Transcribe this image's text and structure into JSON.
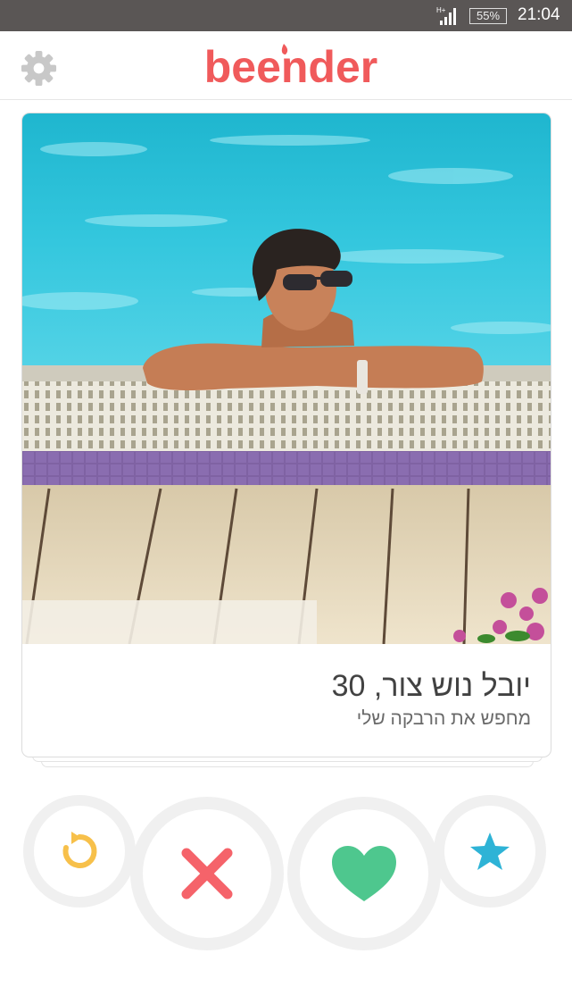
{
  "status_bar": {
    "network": "H+",
    "battery": "55%",
    "time": "21:04"
  },
  "header": {
    "logo_text": "beender",
    "settings_icon": "gear-icon",
    "brand_color": "#f05a5b"
  },
  "card": {
    "name_age": "יובל נוש צור, 30",
    "tagline": "מחפש את הרבקה שלי"
  },
  "actions": [
    {
      "icon": "undo-icon",
      "color": "#f7c04a"
    },
    {
      "icon": "close-icon",
      "color": "#f5636a"
    },
    {
      "icon": "heart-icon",
      "color": "#4ec78e"
    },
    {
      "icon": "star-icon",
      "color": "#2eb3d6"
    }
  ]
}
